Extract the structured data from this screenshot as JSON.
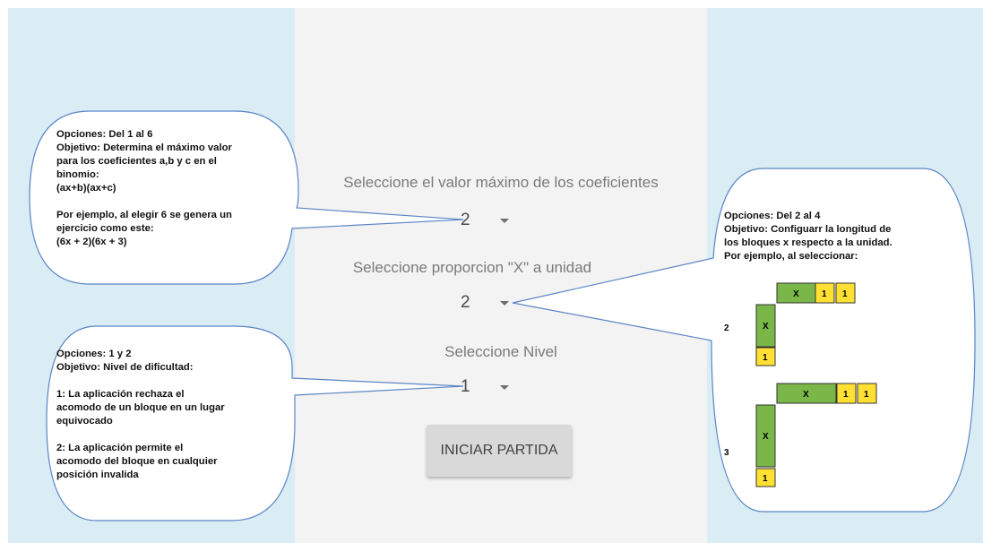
{
  "config": {
    "coef_label": "Seleccione el valor máximo de los coeficientes",
    "coef_value": "2",
    "ratio_label": "Seleccione proporcion \"X\" a unidad",
    "ratio_value": "2",
    "level_label": "Seleccione Nivel",
    "level_value": "1",
    "start_button": "INICIAR PARTIDA"
  },
  "callouts": {
    "coef": "Opciones: Del 1 al 6\nObjetivo: Determina el máximo valor\npara los coeficientes a,b y c en el\nbinomio:\n(ax+b)(ax+c)\n\nPor ejemplo, al elegir 6 se genera un\nejercicio como este:\n (6x + 2)(6x + 3)",
    "level": "Opciones: 1 y 2\nObjetivo: Nivel de dificultad:\n\n1: La aplicación rechaza el\nacomodo de un bloque en un lugar\nequivocado\n\n2: La aplicación permite el\nacomodo del bloque en cualquier\nposición invalida",
    "ratio": "Opciones: Del 2 al 4\nObjetivo: Configuarr la longitud de\nlos bloques x respecto a la unidad.\nPor ejemplo, al seleccionar:"
  },
  "examples": [
    {
      "ratio": "2",
      "x_label": "X",
      "unit_label": "1"
    },
    {
      "ratio": "3",
      "x_label": "X",
      "unit_label": "1"
    }
  ],
  "colors": {
    "x_block": "#7ab648",
    "unit_block": "#ffe033",
    "bubble_border": "#5b85c6",
    "side_panel": "#daedf4",
    "center_panel": "#f3f3f3"
  }
}
